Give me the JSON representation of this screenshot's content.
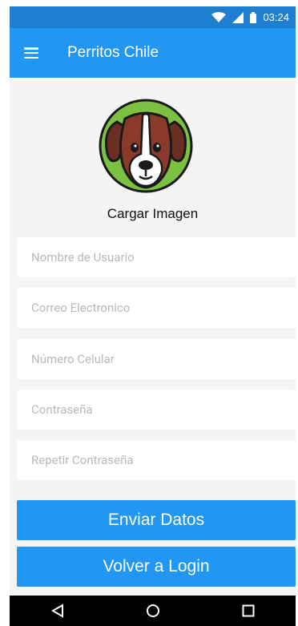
{
  "status_bar": {
    "time": "03:24",
    "icons": [
      "wifi-icon",
      "signal-icon",
      "battery-icon"
    ]
  },
  "app_bar": {
    "title": "Perritos Chile",
    "menu_icon": "hamburger-menu-icon"
  },
  "profile": {
    "avatar_icon": "dog-avatar-icon",
    "upload_label": "Cargar Imagen"
  },
  "form": {
    "username_placeholder": "Nombre de Usuario",
    "email_placeholder": "Correo Electronico",
    "phone_placeholder": "Número Celular",
    "password_placeholder": "Contraseña",
    "repeat_password_placeholder": "Repetir Contraseña"
  },
  "actions": {
    "submit_label": "Enviar Datos",
    "back_label": "Volver a Login"
  },
  "nav": {
    "icons": [
      "back-triangle-icon",
      "home-circle-icon",
      "recents-square-icon"
    ]
  },
  "colors": {
    "primary": "#2196f3",
    "status_bar": "#1e7fd0",
    "background": "#f4f4f4",
    "avatar_ring": "#7cc142",
    "dog_brown": "#6b2e22"
  }
}
